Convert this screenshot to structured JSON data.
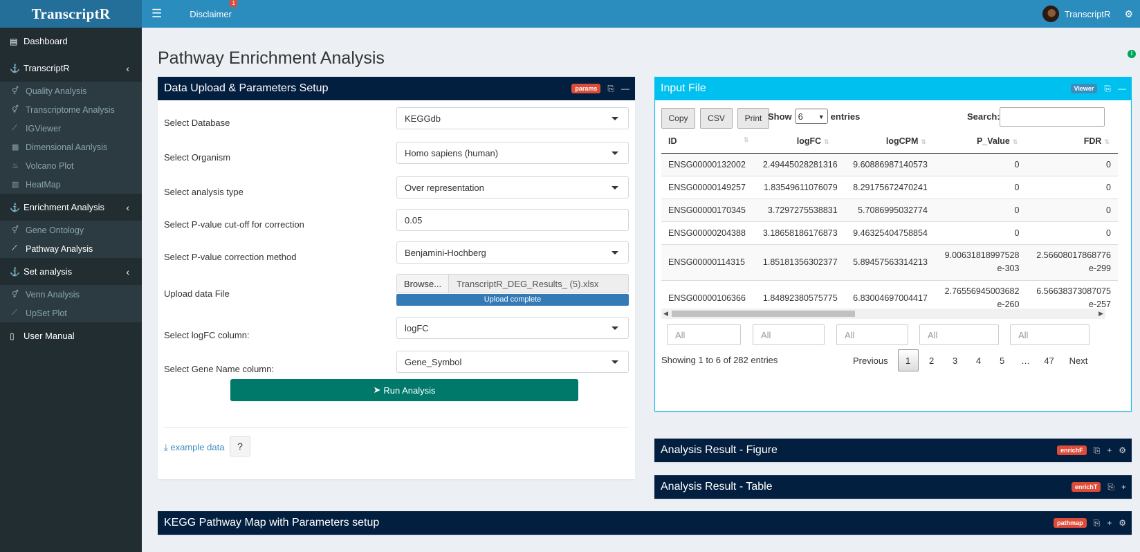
{
  "app": {
    "brand": "TranscriptR",
    "disclaimer": "Disclaimer",
    "disclaimer_badge": "1",
    "user_name": "TranscriptR"
  },
  "sidebar": {
    "dashboard": "Dashboard",
    "transcriptr": "TranscriptR",
    "transcriptr_items": [
      "Quality Analysis",
      "Transcriptome Analysis",
      "IGViewer",
      "Dimensional Aanlysis",
      "Volcano Plot",
      "HeatMap"
    ],
    "enrichment": "Enrichment Analysis",
    "enrichment_items": [
      "Gene Ontology",
      "Pathway Analysis"
    ],
    "set_analysis": "Set analysis",
    "set_items": [
      "Venn Analysis",
      "UpSet Plot"
    ],
    "user_manual": "User Manual"
  },
  "page": {
    "title": "Pathway Enrichment Analysis"
  },
  "params_box": {
    "title": "Data Upload & Parameters Setup",
    "tag": "params",
    "database_label": "Select Database",
    "database_value": "KEGGdb",
    "organism_label": "Select Organism",
    "organism_value": "Homo sapiens (human)",
    "analysis_type_label": "Select analysis type",
    "analysis_type_value": "Over representation",
    "pvalue_cutoff_label": "Select P-value cut-off for correction",
    "pvalue_cutoff_value": "0.05",
    "correction_label": "Select P-value correction method",
    "correction_value": "Benjamini-Hochberg",
    "upload_label": "Upload data File",
    "browse": "Browse...",
    "file_name": "TranscriptR_DEG_Results_ (5).xlsx",
    "upload_status": "Upload complete",
    "logfc_label": "Select logFC column:",
    "logfc_value": "logFC",
    "gene_name_label": "Select Gene Name column:",
    "gene_name_value": "Gene_Symbol",
    "run_button": "Run Analysis",
    "example_link": "example data",
    "help_button": "?"
  },
  "input_box": {
    "title": "Input File",
    "tag": "Viewer",
    "copy": "Copy",
    "csv": "CSV",
    "print": "Print",
    "show_label": "Show",
    "show_value": "6",
    "entries_label": "entries",
    "search_label": "Search:",
    "columns": [
      "ID",
      "logFC",
      "logCPM",
      "P_Value",
      "FDR"
    ],
    "rows": [
      [
        "ENSG00000132002",
        "2.49445028281316",
        "9.60886987140573",
        "0",
        "0"
      ],
      [
        "ENSG00000149257",
        "1.83549611076079",
        "8.29175672470241",
        "0",
        "0"
      ],
      [
        "ENSG00000170345",
        "3.7297275538831",
        "5.7086995032774",
        "0",
        "0"
      ],
      [
        "ENSG00000204388",
        "3.18658186176873",
        "9.46325404758854",
        "0",
        "0"
      ],
      [
        "ENSG00000114315",
        "1.85181356302377",
        "5.89457563314213",
        "9.00631818997528e-303",
        "2.56608017868776e-299"
      ],
      [
        "ENSG00000106366",
        "1.84892380575775",
        "6.83004697004417",
        "2.76556945003682e-260",
        "6.56638373087075e-257"
      ]
    ],
    "filter_placeholder": "All",
    "info": "Showing 1 to 6 of 282 entries",
    "pager": [
      "Previous",
      "1",
      "2",
      "3",
      "4",
      "5",
      "…",
      "47",
      "Next"
    ]
  },
  "figure_box": {
    "title": "Analysis Result - Figure",
    "tag": "enrichF"
  },
  "table_box": {
    "title": "Analysis Result - Table",
    "tag": "enrichT"
  },
  "kegg_box": {
    "title": "KEGG Pathway Map with Parameters setup",
    "tag": "pathmap"
  }
}
